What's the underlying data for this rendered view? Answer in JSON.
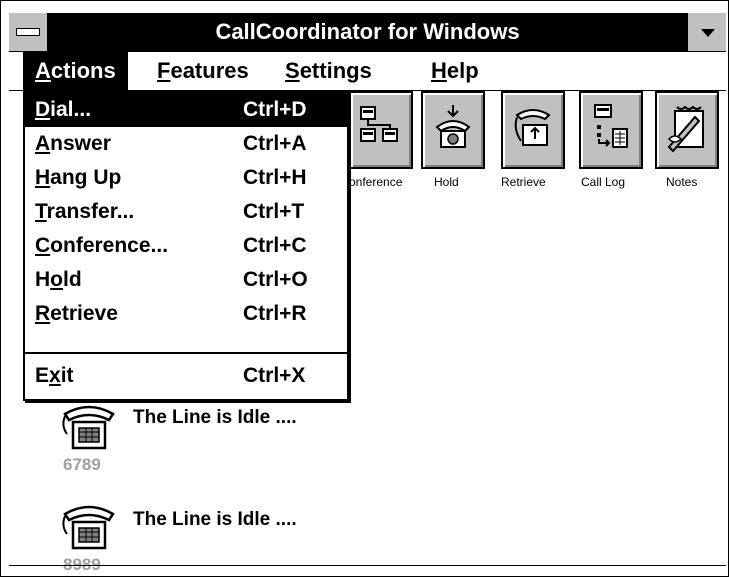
{
  "window": {
    "title": "CallCoordinator for Windows"
  },
  "menubar": {
    "items": [
      {
        "pre": "",
        "ul": "A",
        "post": "ctions"
      },
      {
        "pre": "",
        "ul": "F",
        "post": "eatures"
      },
      {
        "pre": "",
        "ul": "S",
        "post": "ettings"
      },
      {
        "pre": "",
        "ul": "H",
        "post": "elp"
      }
    ]
  },
  "toolbar": {
    "buttons": [
      {
        "label": "onference",
        "icon": "conference-icon"
      },
      {
        "label": "Hold",
        "icon": "hold-icon"
      },
      {
        "label": "Retrieve",
        "icon": "retrieve-icon"
      },
      {
        "label": "Call Log",
        "icon": "call-log-icon"
      },
      {
        "label": "Notes",
        "icon": "notes-icon"
      }
    ]
  },
  "actions_menu": {
    "items": [
      {
        "pre": "",
        "ul": "D",
        "post": "ial...",
        "shortcut": "Ctrl+D"
      },
      {
        "pre": "",
        "ul": "A",
        "post": "nswer",
        "shortcut": "Ctrl+A"
      },
      {
        "pre": "",
        "ul": "H",
        "post": "ang Up",
        "shortcut": "Ctrl+H"
      },
      {
        "pre": "",
        "ul": "T",
        "post": "ransfer...",
        "shortcut": "Ctrl+T"
      },
      {
        "pre": "",
        "ul": "C",
        "post": "onference...",
        "shortcut": "Ctrl+C"
      },
      {
        "pre": "H",
        "ul": "o",
        "post": "ld",
        "shortcut": "Ctrl+O"
      },
      {
        "pre": "",
        "ul": "R",
        "post": "etrieve",
        "shortcut": "Ctrl+R"
      },
      {
        "pre": "E",
        "ul": "x",
        "post": "it",
        "shortcut": "Ctrl+X"
      }
    ]
  },
  "lines": [
    {
      "status": "The Line is Idle ....",
      "number": "6789"
    },
    {
      "status": "The Line is Idle ....",
      "number": "8989"
    }
  ]
}
